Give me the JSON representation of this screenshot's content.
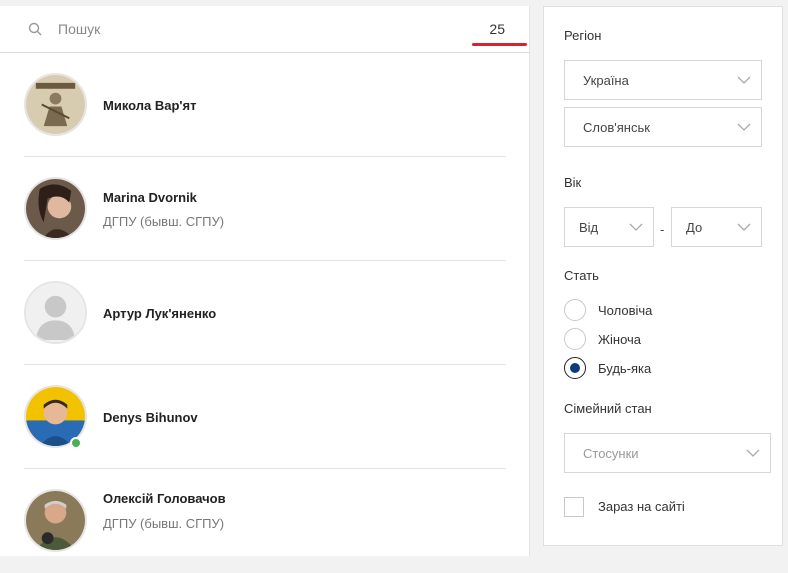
{
  "search": {
    "placeholder": "Пошук",
    "count": "25"
  },
  "people": [
    {
      "name": "Микола Вар'ят",
      "sub": "",
      "online": false,
      "avatar": "sketch"
    },
    {
      "name": "Marina Dvornik",
      "sub": "ДГПУ (бывш. СГПУ)",
      "online": false,
      "avatar": "woman"
    },
    {
      "name": "Артур Лук'яненко",
      "sub": "",
      "online": false,
      "avatar": "default"
    },
    {
      "name": "Denys Bihunov",
      "sub": "",
      "online": true,
      "avatar": "man"
    },
    {
      "name": "Олексій Головачов",
      "sub": "ДГПУ (бывш. СГПУ)",
      "online": false,
      "avatar": "older-man"
    }
  ],
  "filters": {
    "region_label": "Регіон",
    "country": "Україна",
    "city": "Слов'янськ",
    "age_label": "Вік",
    "age_from": "Від",
    "age_separator": "-",
    "age_to": "До",
    "gender_label": "Стать",
    "gender_options": [
      "Чоловіча",
      "Жіноча",
      "Будь-яка"
    ],
    "gender_selected": "Будь-яка",
    "family_label": "Сімейний стан",
    "family_placeholder": "Стосунки",
    "online_label": "Зараз на сайті"
  },
  "colors": {
    "accent_underline": "#d8232a",
    "radio_dot": "#0d3b7a",
    "online_dot": "#4caf50"
  }
}
